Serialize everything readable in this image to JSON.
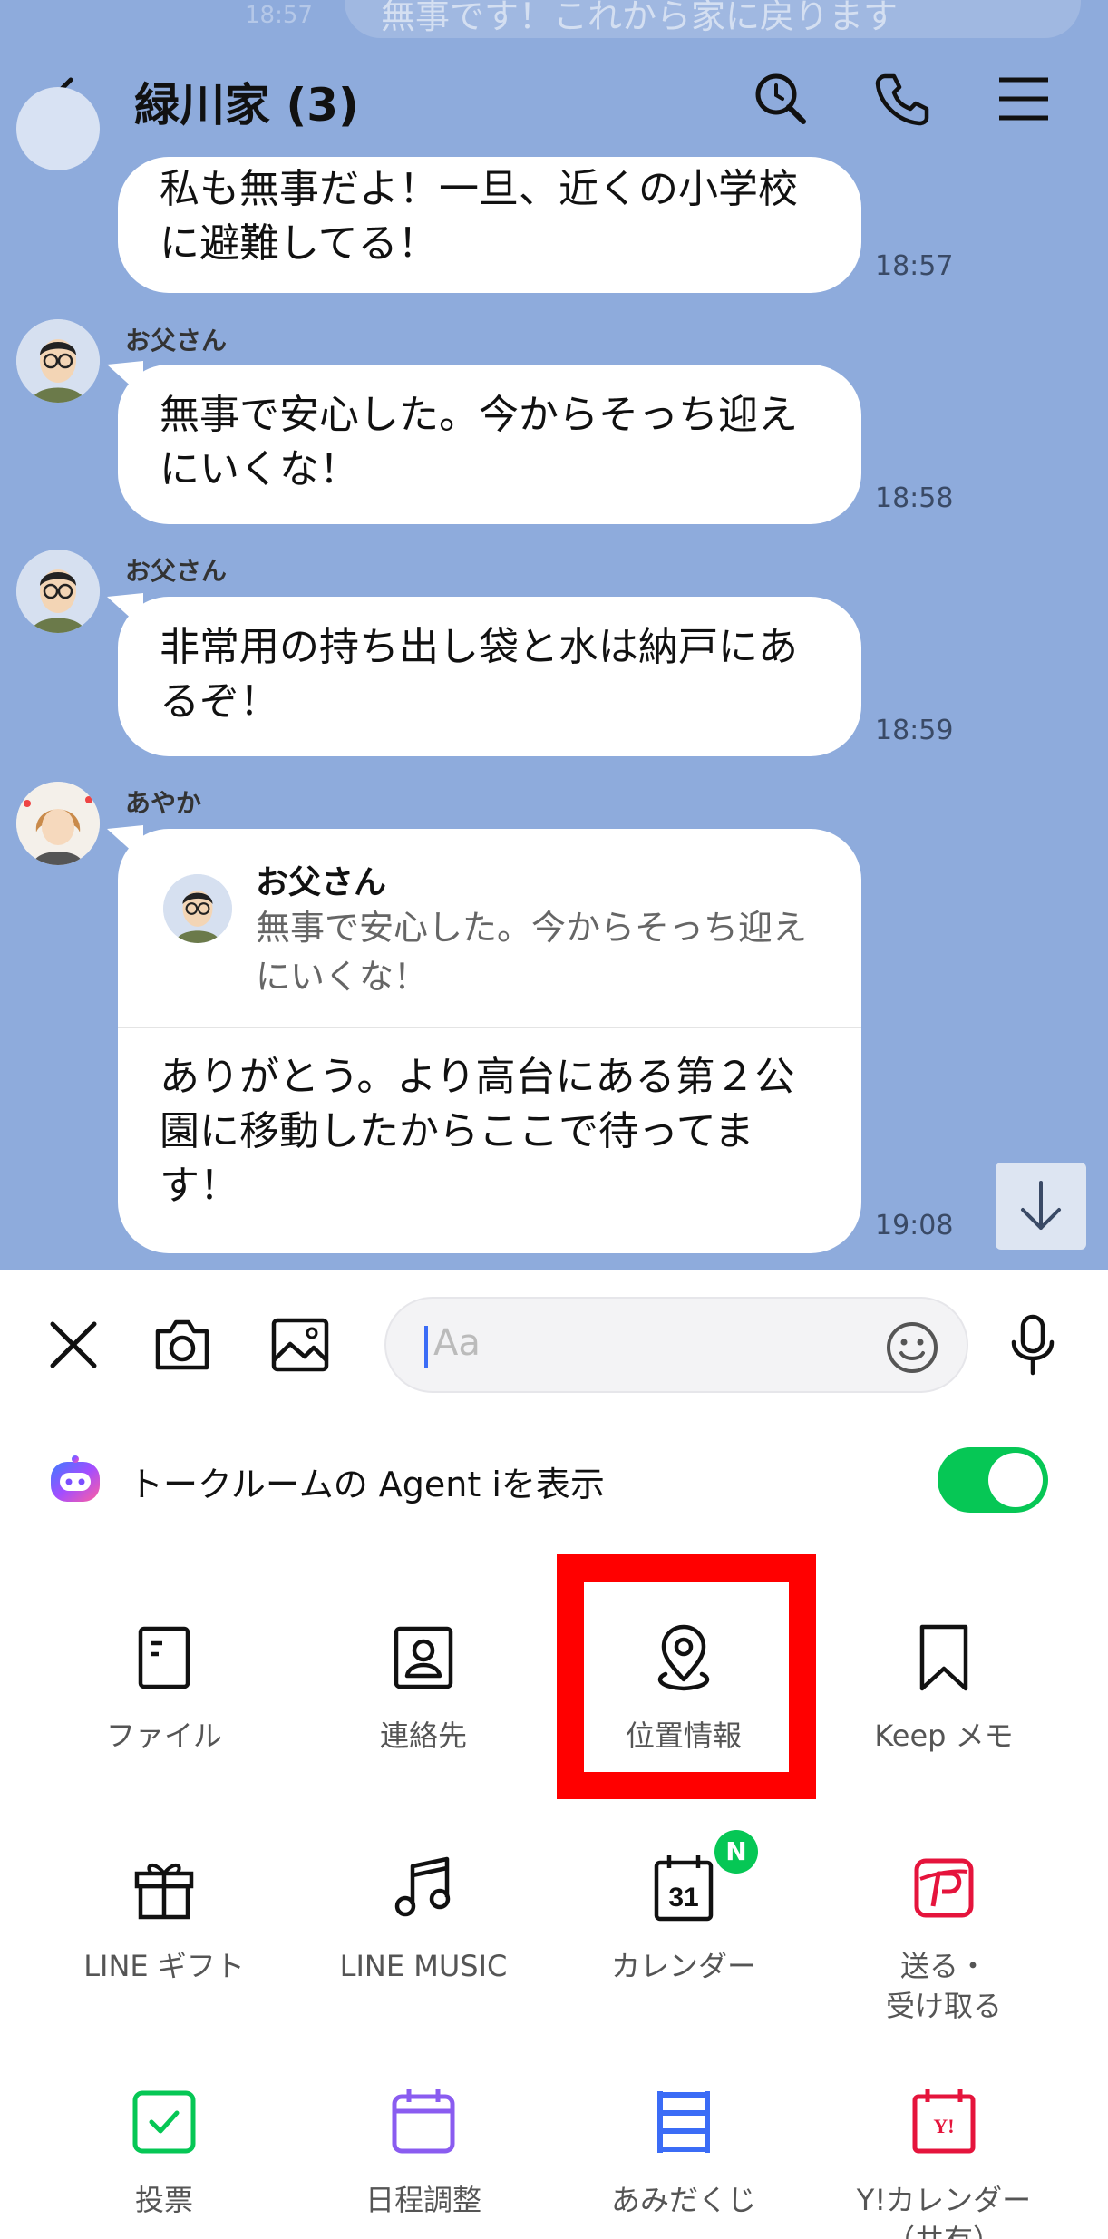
{
  "ghost": {
    "text": "無事です！これから家に戻ります",
    "time": "18:57"
  },
  "header": {
    "title": "緑川家 (3)"
  },
  "messages": [
    {
      "sender": "",
      "text": "私も無事だよ！一旦、近くの小学校に避難してる！",
      "time": "18:57"
    },
    {
      "sender": "お父さん",
      "text": "無事で安心した。今からそっち迎えにいくな！",
      "time": "18:58"
    },
    {
      "sender": "お父さん",
      "text": "非常用の持ち出し袋と水は納戸にあるぞ！",
      "time": "18:59"
    },
    {
      "sender": "あやか",
      "quote_name": "お父さん",
      "quote_text": "無事で安心した。今からそっち迎えにいくな！",
      "text": "ありがとう。より高台にある第２公園に移動したからここで待ってます！",
      "time": "19:08"
    }
  ],
  "input": {
    "placeholder": "Aa"
  },
  "agent": {
    "label": "トークルームの Agent iを表示",
    "enabled": true
  },
  "menu": [
    {
      "label": "ファイル",
      "icon": "file-icon"
    },
    {
      "label": "連絡先",
      "icon": "contact-icon"
    },
    {
      "label": "位置情報",
      "icon": "location-icon"
    },
    {
      "label": "Keep メモ",
      "icon": "bookmark-icon"
    },
    {
      "label": "LINE ギフト",
      "icon": "gift-icon"
    },
    {
      "label": "LINE MUSIC",
      "icon": "music-icon"
    },
    {
      "label": "カレンダー",
      "icon": "calendar-icon",
      "badge": "N"
    },
    {
      "label": "送る・\n受け取る",
      "icon": "paypay-icon"
    },
    {
      "label": "投票",
      "icon": "vote-icon"
    },
    {
      "label": "日程調整",
      "icon": "schedule-icon"
    },
    {
      "label": "あみだくじ",
      "icon": "ladder-icon"
    },
    {
      "label": "Y!カレンダー\n（共有）",
      "icon": "ycalendar-icon"
    }
  ],
  "colors": {
    "chat_bg": "#8eabdc",
    "accent_green": "#06c755",
    "highlight": "#ff0000"
  }
}
